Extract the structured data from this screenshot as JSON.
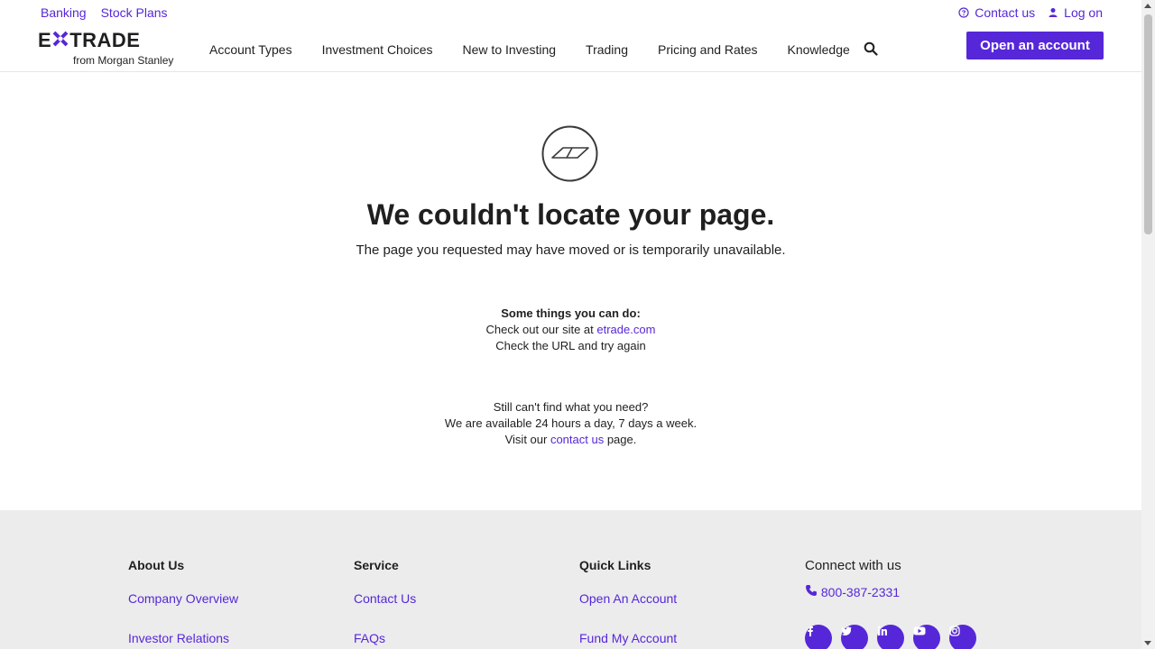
{
  "header": {
    "util_left": [
      "Banking",
      "Stock Plans"
    ],
    "contact_label": "Contact us",
    "logon_label": "Log on",
    "logo_main_left": "E",
    "logo_main_right": "TRADE",
    "logo_sub": "from Morgan Stanley",
    "nav": [
      "Account Types",
      "Investment Choices",
      "New to Investing",
      "Trading",
      "Pricing and Rates",
      "Knowledge"
    ],
    "cta_label": "Open an account"
  },
  "main": {
    "title": "We couldn't locate your page.",
    "subtitle": "The page you requested may have moved or is temporarily unavailable.",
    "things_heading": "Some things you can do:",
    "check_site_prefix": "Check out our site at ",
    "check_site_link": "etrade.com",
    "check_url": "Check the URL and try again",
    "still_cant": "Still can't find what you need?",
    "available": "We are available 24 hours a day, 7 days a week.",
    "visit_prefix": "Visit our ",
    "visit_link": "contact us",
    "visit_suffix": " page."
  },
  "footer": {
    "about": {
      "heading": "About Us",
      "links": [
        "Company Overview",
        "Investor Relations"
      ]
    },
    "service": {
      "heading": "Service",
      "links": [
        "Contact Us",
        "FAQs"
      ]
    },
    "quick": {
      "heading": "Quick Links",
      "links": [
        "Open An Account",
        "Fund My Account"
      ]
    },
    "connect": {
      "heading": "Connect with us",
      "phone": "800-387-2331"
    },
    "socials": [
      "facebook-icon",
      "twitter-icon",
      "linkedin-icon",
      "youtube-icon",
      "instagram-icon"
    ]
  },
  "colors": {
    "brand": "#5627d8",
    "text": "#1f1f1f",
    "footer_bg": "#ececec"
  }
}
